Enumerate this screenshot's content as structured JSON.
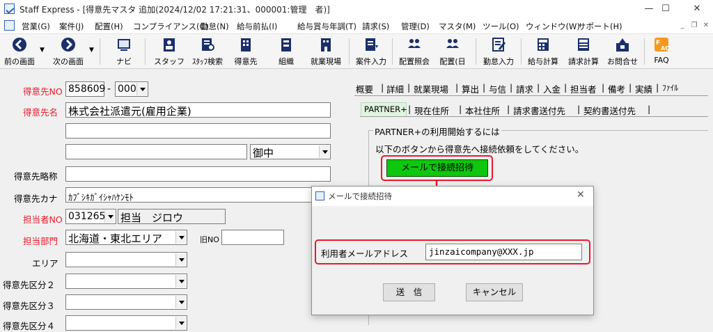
{
  "window": {
    "title": "Staff Express - [得意先マスタ 追加(2024/12/02 17:21:31、000001:管理　者)]",
    "minimize_glyph": "—",
    "maximize_glyph": "☐",
    "close_glyph": "✕"
  },
  "menu": {
    "items": [
      "営業(G)",
      "案件(J)",
      "配置(H)",
      "コンプライアンス(C)",
      "勤怠(N)",
      "給与前払(I)",
      "給与賞与年調(T)",
      "請求(S)",
      "管理(D)",
      "マスタ(M)",
      "ツール(O)",
      "ウィンドウ(W)",
      "サポート(H)"
    ],
    "mdi_minimize": "_",
    "mdi_restore": "❐",
    "mdi_close": "✕"
  },
  "toolbar": {
    "buttons": [
      {
        "label": "前の画面",
        "icon": "back-arrow-icon"
      },
      {
        "label": "次の画面",
        "icon": "forward-arrow-icon"
      },
      {
        "label": "ナビ",
        "icon": "navi-icon"
      },
      {
        "label": "スタッフ",
        "icon": "staff-icon"
      },
      {
        "label": "ｽﾀｯﾌ検索",
        "icon": "staff-search-icon"
      },
      {
        "label": "得意先",
        "icon": "customer-icon"
      },
      {
        "label": "組織",
        "icon": "organization-icon"
      },
      {
        "label": "就業現場",
        "icon": "worksite-icon"
      },
      {
        "label": "案件入力",
        "icon": "job-input-icon"
      },
      {
        "label": "配置照会",
        "icon": "placement-inquiry-icon"
      },
      {
        "label": "配置(日",
        "icon": "placement-daily-icon"
      },
      {
        "label": "勤怠入力",
        "icon": "attendance-input-icon"
      },
      {
        "label": "給与計算",
        "icon": "payroll-icon"
      },
      {
        "label": "請求計算",
        "icon": "billing-icon"
      },
      {
        "label": "お問合せ",
        "icon": "inquiry-icon"
      },
      {
        "label": "FAQ",
        "icon": "faq-icon"
      }
    ]
  },
  "form": {
    "customer_no_label": "得意先NO",
    "customer_no": "858609",
    "customer_no_sep": "-",
    "customer_no_branch": "000",
    "customer_name_label": "得意先名",
    "customer_name": "株式会社派遣元(雇用企業)",
    "honorific": "御中",
    "short_name_label": "得意先略称",
    "kana_label": "得意先カナ",
    "kana_value": "ｶﾌﾞｼｷｶﾞｲｼｬﾊｹﾝﾓﾄ",
    "staff_no_label": "担当者NO",
    "staff_no": "031265",
    "staff_name": "担当　ジロウ",
    "dept_label": "担当部門",
    "dept_value": "北海道・東北エリア",
    "old_no_label": "旧NO",
    "area_label": "エリア",
    "category2_label": "得意先区分２",
    "category3_label": "得意先区分３",
    "category4_label": "得意先区分４"
  },
  "tabs": {
    "main": [
      "概要",
      "詳細",
      "就業現場",
      "算出",
      "与信",
      "請求",
      "入金",
      "担当者",
      "備考",
      "実績",
      "ﾌｧｲﾙ"
    ],
    "sub": [
      "PARTNER+",
      "現在住所",
      "本社住所",
      "請求書送付先",
      "契約書送付先"
    ]
  },
  "partner": {
    "group_title": "PARTNER+の利用開始するには",
    "instruction": "以下のボタンから得意先へ接続依頼をしてください。",
    "invite_button": "メールで接続招待"
  },
  "dialog": {
    "title": "メールで接続招待",
    "email_label": "利用者メールアドレス",
    "email_value": "jinzaicompany@XXX.jp",
    "send_button": "送　信",
    "cancel_button": "キャンセル"
  },
  "colors": {
    "required_label": "#e8192c",
    "highlight_frame": "#e8192c",
    "invite_button": "#0ec70e",
    "partner_tab_bg": "#dff5df",
    "dialog_button_bg": "#e1e1e1"
  }
}
